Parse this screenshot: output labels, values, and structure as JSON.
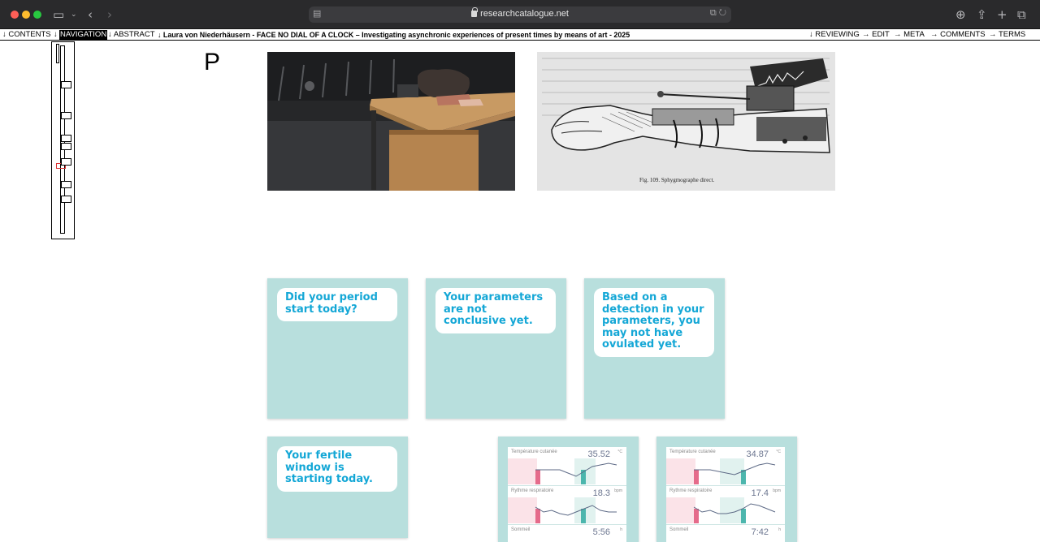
{
  "browser": {
    "url": "researchcatalogue.net"
  },
  "nav": {
    "contents": "↓ CONTENTS",
    "navigation_arrow": "↓",
    "navigation": "NAVIGATION",
    "abstract": "↓ ABSTRACT",
    "title": "↓  Laura von Niederhäusern - FACE NO DIAL OF A CLOCK – Investigating asynchronic experiences of present times by means of art - 2025",
    "reviewing": "↓ REVIEWING",
    "edit": "→ EDIT",
    "meta": "→ META",
    "comments": "→ COMMENTS",
    "terms": "→ TERMS"
  },
  "page": {
    "letter": "P",
    "engraving_caption": "Fig. 109. Sphygmographe direct."
  },
  "cards": [
    {
      "text": "Did your period start today?"
    },
    {
      "text": "Your parameters are not conclusive yet."
    },
    {
      "text": "Based on a detection in your parameters, you may not have ovulated yet."
    },
    {
      "text": "Your fertile window is starting today."
    }
  ],
  "chart_cards": [
    {
      "metrics": [
        {
          "label": "Température cutanée",
          "value": "35.52",
          "unit": "°C"
        },
        {
          "label": "Rythme respiratoire",
          "value": "18.3",
          "unit": "bpm"
        },
        {
          "label": "Sommeil",
          "value": "5:56",
          "unit": "h"
        }
      ]
    },
    {
      "metrics": [
        {
          "label": "Température cutanée",
          "value": "34.87",
          "unit": "°C"
        },
        {
          "label": "Rythme respiratoire",
          "value": "17.4",
          "unit": "bpm"
        },
        {
          "label": "Sommeil",
          "value": "7:42",
          "unit": "h"
        }
      ]
    }
  ],
  "colors": {
    "card_bg": "#b8dfdd",
    "bubble_text": "#14a7d6"
  }
}
